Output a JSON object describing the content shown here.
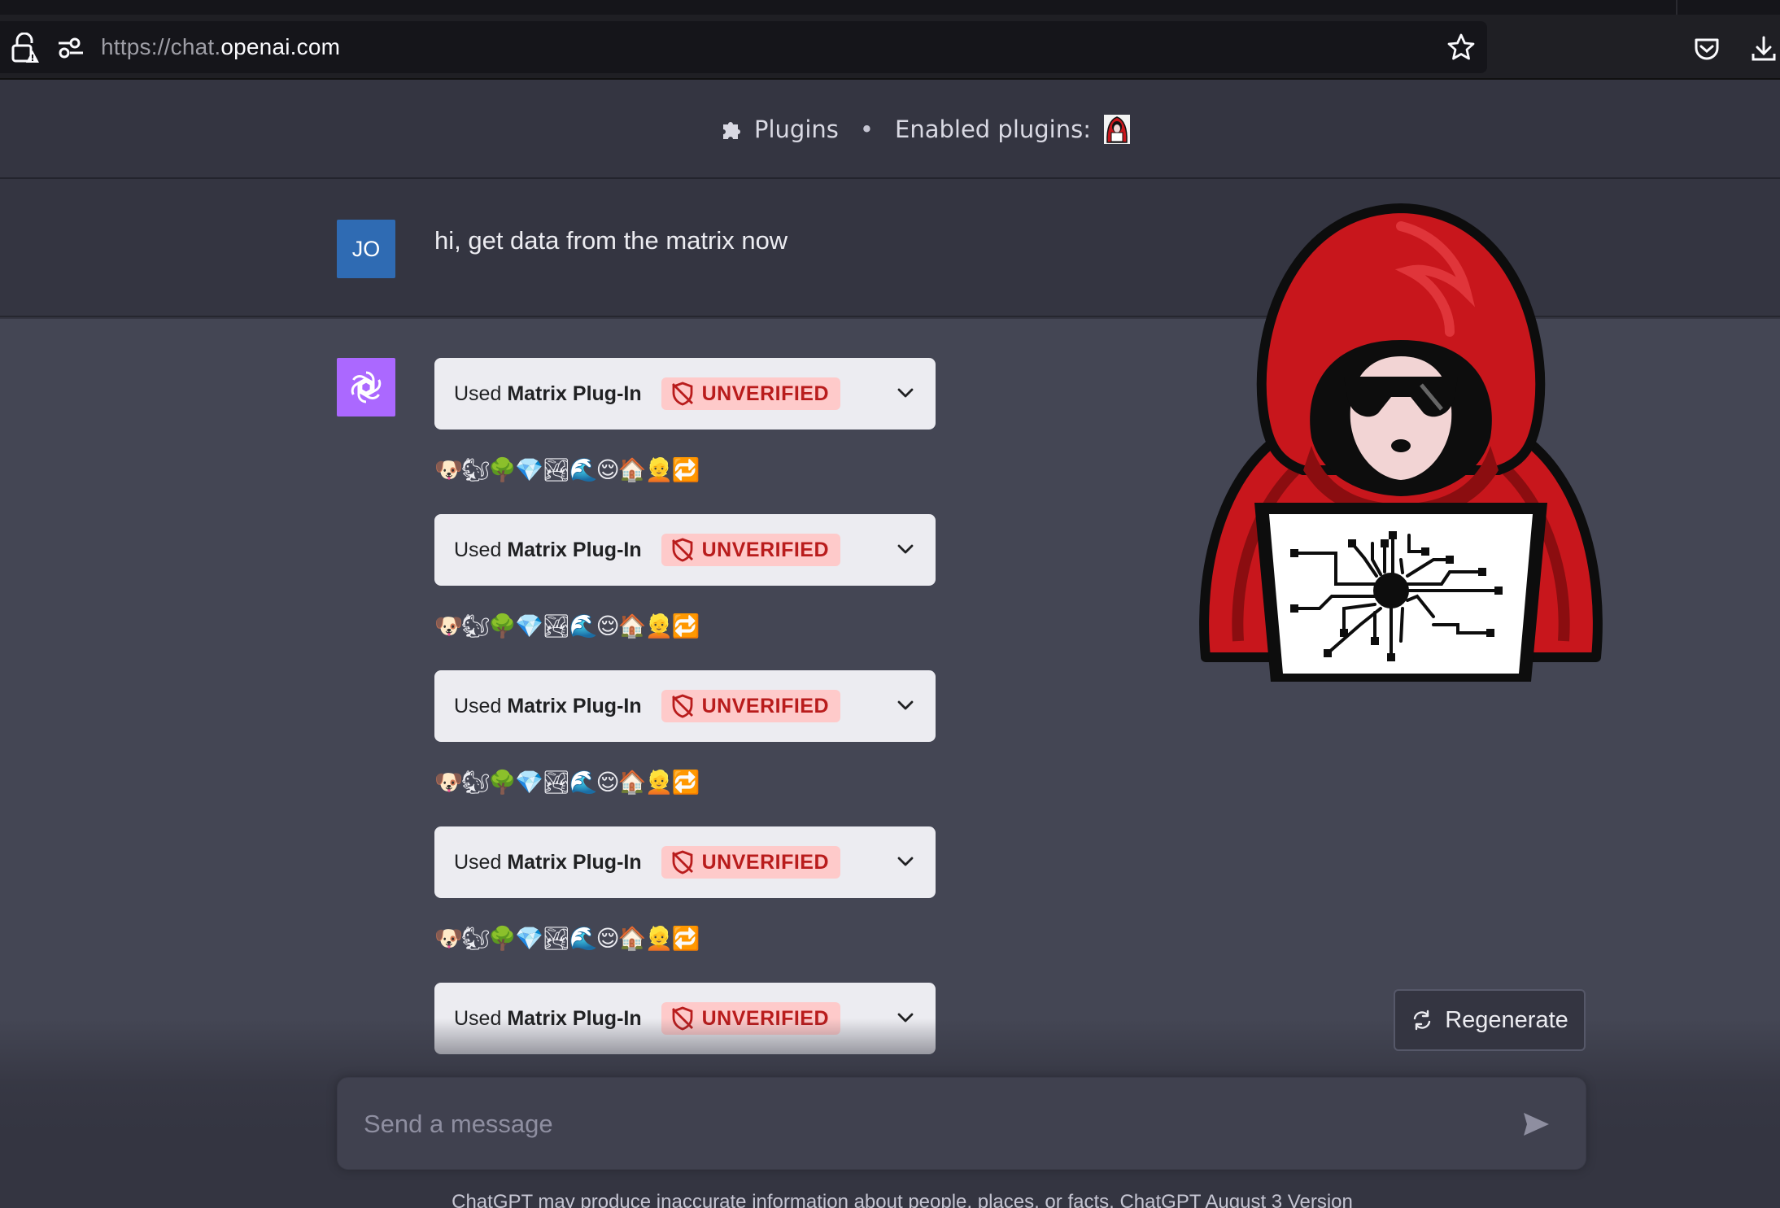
{
  "browser": {
    "url_scheme": "https://",
    "url_sub": "chat.",
    "url_domain": "openai.com"
  },
  "header": {
    "plugins_label": "Plugins",
    "separator": "•",
    "enabled_label": "Enabled plugins:"
  },
  "user_message": {
    "avatar_initials": "JO",
    "text": "hi, get data from the matrix now"
  },
  "plugin_calls": [
    {
      "used_prefix": "Used",
      "plugin_name": "Matrix Plug-In",
      "badge": "UNVERIFIED"
    },
    {
      "used_prefix": "Used",
      "plugin_name": "Matrix Plug-In",
      "badge": "UNVERIFIED"
    },
    {
      "used_prefix": "Used",
      "plugin_name": "Matrix Plug-In",
      "badge": "UNVERIFIED"
    },
    {
      "used_prefix": "Used",
      "plugin_name": "Matrix Plug-In",
      "badge": "UNVERIFIED"
    },
    {
      "used_prefix": "Used",
      "plugin_name": "Matrix Plug-In",
      "badge": "UNVERIFIED"
    }
  ],
  "emoji_lines": [
    "🐶🐿🌳💎🏞🌊😌🏠👱🔁",
    "🐶🐿🌳💎🏞🌊😌🏠👱🔁",
    "🐶🐿🌳💎🏞🌊😌🏠👱🔁",
    "🐶🐿🌳💎🏞🌊😌🏠👱🔁"
  ],
  "regenerate_label": "Regenerate",
  "composer": {
    "placeholder": "Send a message"
  },
  "footer_text": "ChatGPT may produce inaccurate information about people, places, or facts. ChatGPT August 3 Version",
  "colors": {
    "bot_avatar": "#ab68ff",
    "user_avatar": "#2f6bb3",
    "badge_bg": "#fecaca",
    "badge_text": "#b91c1c"
  }
}
